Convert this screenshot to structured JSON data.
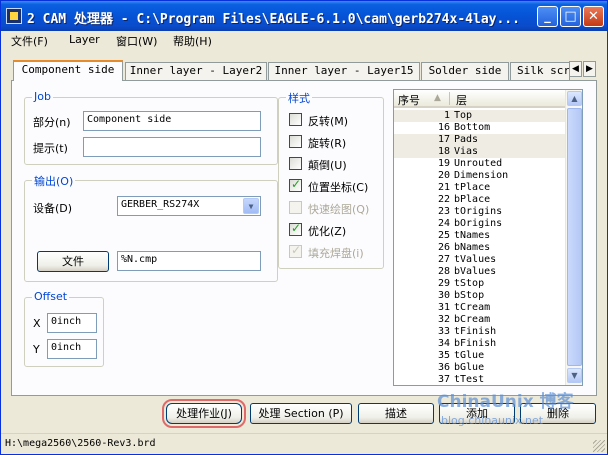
{
  "window": {
    "title": "2 CAM 处理器 - C:\\Program Files\\EAGLE-6.1.0\\cam\\gerb274x-4lay...",
    "controls": [
      "_",
      "□",
      "✕"
    ]
  },
  "menu": [
    "文件(F)",
    "Layer",
    "窗口(W)",
    "帮助(H)"
  ],
  "tabs": [
    "Component side",
    "Inner layer - Layer2",
    "Inner layer - Layer15",
    "Solder side",
    "Silk scr"
  ],
  "job": {
    "legend": "Job",
    "section_label": "部分(n)",
    "section_value": "Component side",
    "prompt_label": "提示(t)",
    "prompt_value": ""
  },
  "output": {
    "legend": "输出(O)",
    "device_label": "设备(D)",
    "device_value": "GERBER_RS274X",
    "file_button": "文件",
    "file_value": "%N.cmp"
  },
  "offset": {
    "legend": "Offset",
    "x_label": "X",
    "x_value": "0inch",
    "y_label": "Y",
    "y_value": "0inch"
  },
  "style": {
    "legend": "样式",
    "options": [
      {
        "label": "反转(M)",
        "checked": false,
        "enabled": true
      },
      {
        "label": "旋转(R)",
        "checked": false,
        "enabled": true
      },
      {
        "label": "颠倒(U)",
        "checked": false,
        "enabled": true
      },
      {
        "label": "位置坐标(C)",
        "checked": true,
        "enabled": true
      },
      {
        "label": "快速绘图(Q)",
        "checked": false,
        "enabled": false
      },
      {
        "label": "优化(Z)",
        "checked": true,
        "enabled": true
      },
      {
        "label": "填充焊盘(i)",
        "checked": true,
        "enabled": false
      }
    ]
  },
  "layers": {
    "col_number": "序号",
    "col_layer": "层",
    "rows": [
      {
        "num": "1",
        "name": "Top",
        "selected": true
      },
      {
        "num": "16",
        "name": "Bottom",
        "selected": false
      },
      {
        "num": "17",
        "name": "Pads",
        "selected": true
      },
      {
        "num": "18",
        "name": "Vias",
        "selected": true
      },
      {
        "num": "19",
        "name": "Unrouted",
        "selected": false
      },
      {
        "num": "20",
        "name": "Dimension",
        "selected": false
      },
      {
        "num": "21",
        "name": "tPlace",
        "selected": false
      },
      {
        "num": "22",
        "name": "bPlace",
        "selected": false
      },
      {
        "num": "23",
        "name": "tOrigins",
        "selected": false
      },
      {
        "num": "24",
        "name": "bOrigins",
        "selected": false
      },
      {
        "num": "25",
        "name": "tNames",
        "selected": false
      },
      {
        "num": "26",
        "name": "bNames",
        "selected": false
      },
      {
        "num": "27",
        "name": "tValues",
        "selected": false
      },
      {
        "num": "28",
        "name": "bValues",
        "selected": false
      },
      {
        "num": "29",
        "name": "tStop",
        "selected": false
      },
      {
        "num": "30",
        "name": "bStop",
        "selected": false
      },
      {
        "num": "31",
        "name": "tCream",
        "selected": false
      },
      {
        "num": "32",
        "name": "bCream",
        "selected": false
      },
      {
        "num": "33",
        "name": "tFinish",
        "selected": false
      },
      {
        "num": "34",
        "name": "bFinish",
        "selected": false
      },
      {
        "num": "35",
        "name": "tGlue",
        "selected": false
      },
      {
        "num": "36",
        "name": "bGlue",
        "selected": false
      },
      {
        "num": "37",
        "name": "tTest",
        "selected": false
      }
    ]
  },
  "buttons": {
    "process_job": "处理作业(J)",
    "process_section": "处理 Section (P)",
    "describe": "描述",
    "add": "添加",
    "delete": "删除"
  },
  "status": "H:\\mega2560\\2560-Rev3.brd",
  "watermark": {
    "main": "ChinaUnix 博客",
    "sub": "blog.chinaunix.net"
  }
}
